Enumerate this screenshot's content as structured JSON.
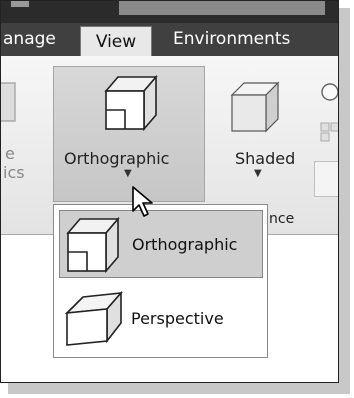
{
  "tabs": {
    "manage": "anage",
    "view": "View",
    "environments": "Environments"
  },
  "ribbon": {
    "orthographic_label": "Orthographic",
    "shaded_label": "Shaded",
    "left_partial_top": "e",
    "left_partial_bottom": "ics",
    "panel_label_partial": "nce"
  },
  "dropdown": {
    "items": [
      {
        "label": "Orthographic",
        "icon": "orthographic-cube-icon",
        "selected": true
      },
      {
        "label": "Perspective",
        "icon": "perspective-box-icon",
        "selected": false
      }
    ]
  }
}
